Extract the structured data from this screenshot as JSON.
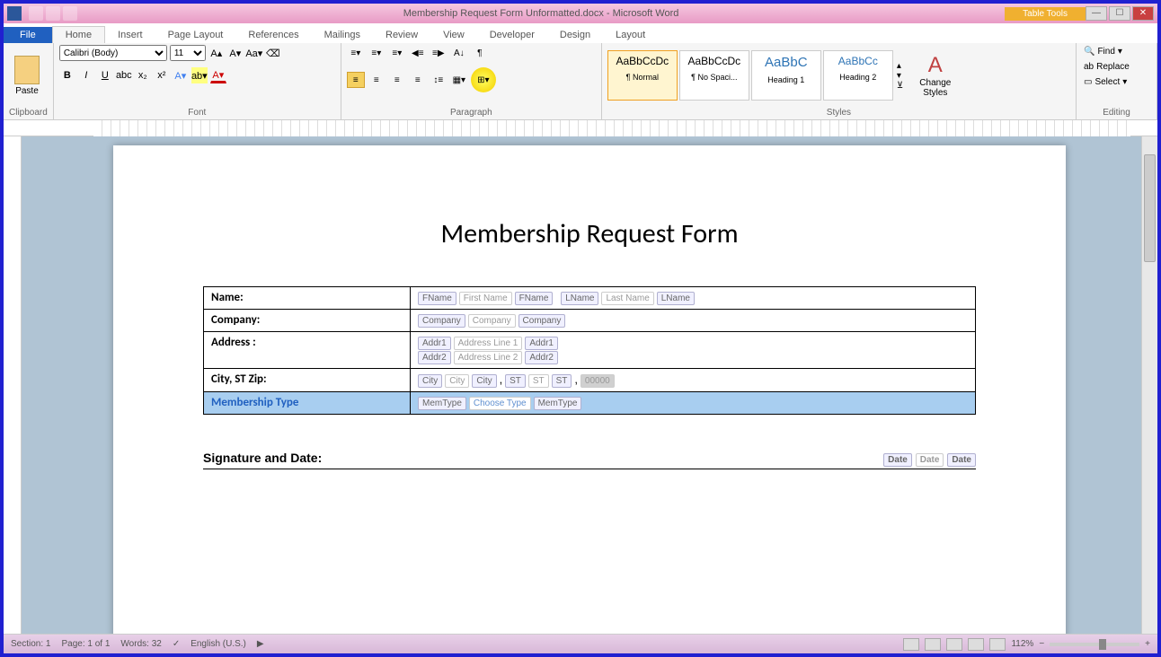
{
  "title": "Membership Request Form Unformatted.docx - Microsoft Word",
  "contexttab": "Table Tools",
  "tabs": {
    "file": "File",
    "list": [
      "Home",
      "Insert",
      "Page Layout",
      "References",
      "Mailings",
      "Review",
      "View",
      "Developer",
      "Design",
      "Layout"
    ],
    "active": "Home"
  },
  "ribbon": {
    "clipboard": {
      "label": "Clipboard",
      "paste": "Paste"
    },
    "font": {
      "label": "Font",
      "name": "Calibri (Body)",
      "size": "11"
    },
    "paragraph": {
      "label": "Paragraph"
    },
    "styles": {
      "label": "Styles",
      "items": [
        {
          "preview": "AaBbCcDc",
          "name": "¶ Normal"
        },
        {
          "preview": "AaBbCcDc",
          "name": "¶ No Spaci..."
        },
        {
          "preview": "AaBbC",
          "name": "Heading 1"
        },
        {
          "preview": "AaBbCc",
          "name": "Heading 2"
        }
      ],
      "change": "Change Styles"
    },
    "editing": {
      "label": "Editing",
      "find": "Find",
      "replace": "Replace",
      "select": "Select"
    }
  },
  "doc": {
    "heading": "Membership Request Form",
    "rows": [
      {
        "label": "Name:",
        "cells": [
          {
            "tag": "FName"
          },
          {
            "ph": "First Name"
          },
          {
            "tag": "FName"
          },
          {
            "tag": "LName"
          },
          {
            "ph": "Last Name"
          },
          {
            "tag": "LName"
          }
        ]
      },
      {
        "label": "Company:",
        "cells": [
          {
            "tag": "Company"
          },
          {
            "ph": "Company"
          },
          {
            "tag": "Company"
          }
        ]
      },
      {
        "label": "Address :",
        "cells": [
          {
            "tag": "Addr1"
          },
          {
            "ph": "Address Line 1"
          },
          {
            "tag": "Addr1"
          }
        ],
        "cells2": [
          {
            "tag": "Addr2"
          },
          {
            "ph": "Address Line 2"
          },
          {
            "tag": "Addr2"
          }
        ]
      },
      {
        "label": "City, ST Zip:",
        "cells": [
          {
            "tag": "City"
          },
          {
            "ph": "City"
          },
          {
            "tag": "City"
          },
          {
            "text": ","
          },
          {
            "tag": "ST"
          },
          {
            "ph": "ST"
          },
          {
            "tag": "ST"
          },
          {
            "text": ","
          },
          {
            "ph": "00000"
          }
        ]
      },
      {
        "label": "Membership Type",
        "sel": true,
        "cells": [
          {
            "tag": "MemType"
          },
          {
            "ph": "Choose Type"
          },
          {
            "tag": "MemType"
          }
        ]
      }
    ],
    "sig": {
      "label": "Signature and Date:",
      "date": {
        "tag": "Date",
        "ph": "Date"
      }
    }
  },
  "status": {
    "section": "Section: 1",
    "page": "Page: 1 of 1",
    "words": "Words: 32",
    "lang": "English (U.S.)",
    "zoom": "112%"
  }
}
